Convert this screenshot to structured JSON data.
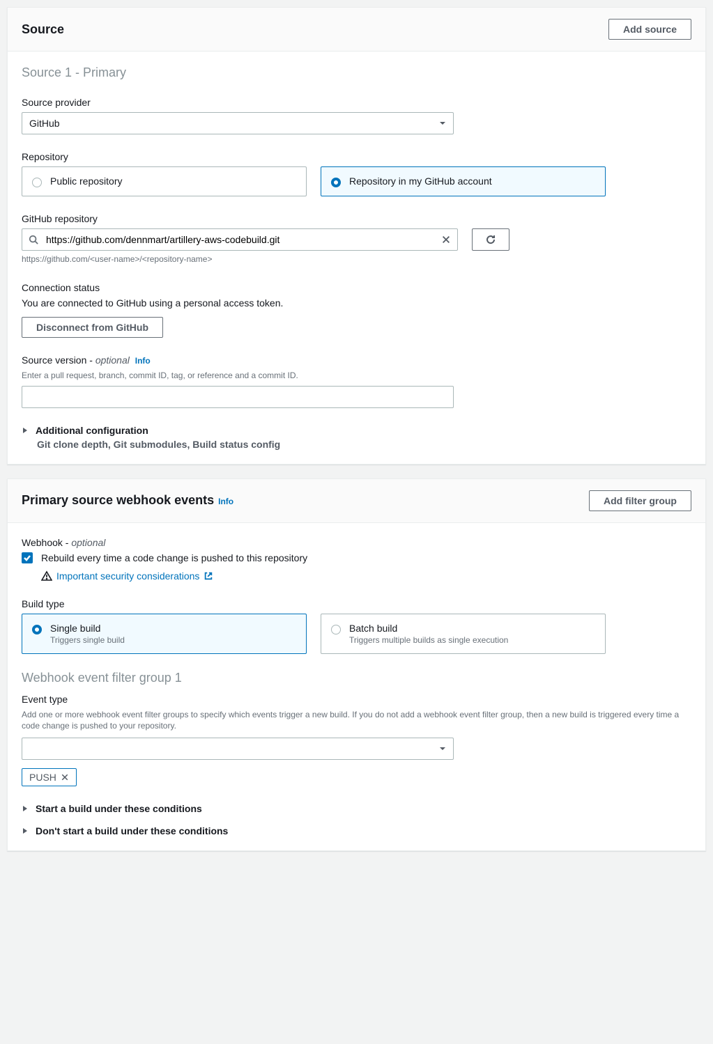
{
  "source": {
    "header_title": "Source",
    "add_button": "Add source",
    "section_label": "Source 1 - Primary",
    "provider_label": "Source provider",
    "provider_value": "GitHub",
    "repository_label": "Repository",
    "repo_options": {
      "public": "Public repository",
      "my_account": "Repository in my GitHub account"
    },
    "gh_repo_label": "GitHub repository",
    "gh_repo_value": "https://github.com/dennmart/artillery-aws-codebuild.git",
    "gh_repo_hint": "https://github.com/<user-name>/<repository-name>",
    "conn_status_label": "Connection status",
    "conn_status_text": "You are connected to GitHub using a personal access token.",
    "disconnect_button": "Disconnect from GitHub",
    "source_version_label": "Source version - ",
    "optional": "optional",
    "info": "Info",
    "source_version_hint": "Enter a pull request, branch, commit ID, tag, or reference and a commit ID.",
    "additional_config": "Additional configuration",
    "additional_config_sub": "Git clone depth, Git submodules, Build status config"
  },
  "webhook": {
    "header_title": "Primary source webhook events",
    "add_filter_button": "Add filter group",
    "webhook_label": "Webhook - ",
    "optional": "optional",
    "checkbox_label": "Rebuild every time a code change is pushed to this repository",
    "security_link": "Important security considerations",
    "build_type_label": "Build type",
    "build_options": {
      "single_title": "Single build",
      "single_sub": "Triggers single build",
      "batch_title": "Batch build",
      "batch_sub": "Triggers multiple builds as single execution"
    },
    "filter_group_title": "Webhook event filter group 1",
    "event_type_label": "Event type",
    "event_type_hint": "Add one or more webhook event filter groups to specify which events trigger a new build. If you do not add a webhook event filter group, then a new build is triggered every time a code change is pushed to your repository.",
    "event_tag": "PUSH",
    "start_conditions": "Start a build under these conditions",
    "dont_start_conditions": "Don't start a build under these conditions",
    "info": "Info"
  }
}
